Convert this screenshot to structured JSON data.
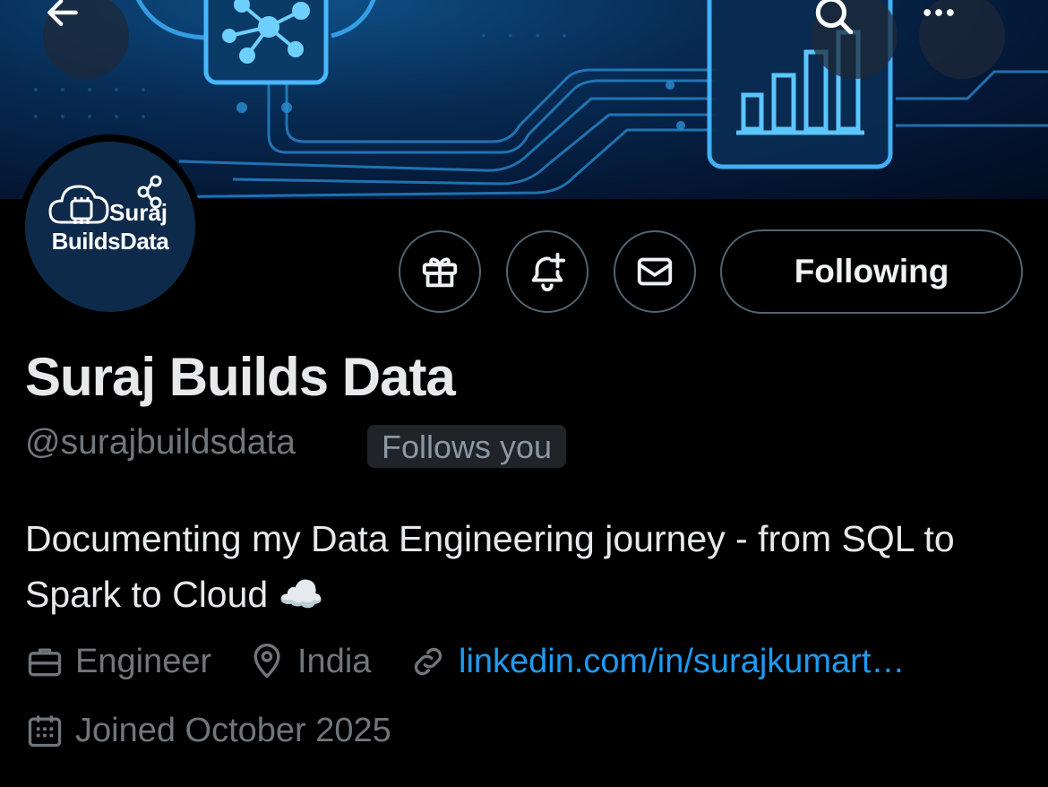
{
  "header": {
    "back_icon": "arrow-left-icon",
    "search_icon": "search-icon",
    "more_icon": "more-horizontal-icon"
  },
  "avatar": {
    "line1": "Suraj",
    "line2": "BuildsData"
  },
  "actions": {
    "gift_icon": "gift-icon",
    "notify_icon": "bell-plus-icon",
    "message_icon": "mail-icon",
    "follow_label": "Following"
  },
  "profile": {
    "name": "Suraj Builds Data",
    "handle": "@surajbuildsdata",
    "follows_you": "Follows you",
    "bio": "Documenting my Data Engineering journey - from SQL to Spark to Cloud ☁️",
    "profession": "Engineer",
    "location": "India",
    "website": "linkedin.com/in/surajkumart…",
    "joined": "Joined October 2025"
  },
  "colors": {
    "accent": "#1d9bf0",
    "muted": "#71767b",
    "text": "#e7e9ea",
    "background": "#000000"
  }
}
